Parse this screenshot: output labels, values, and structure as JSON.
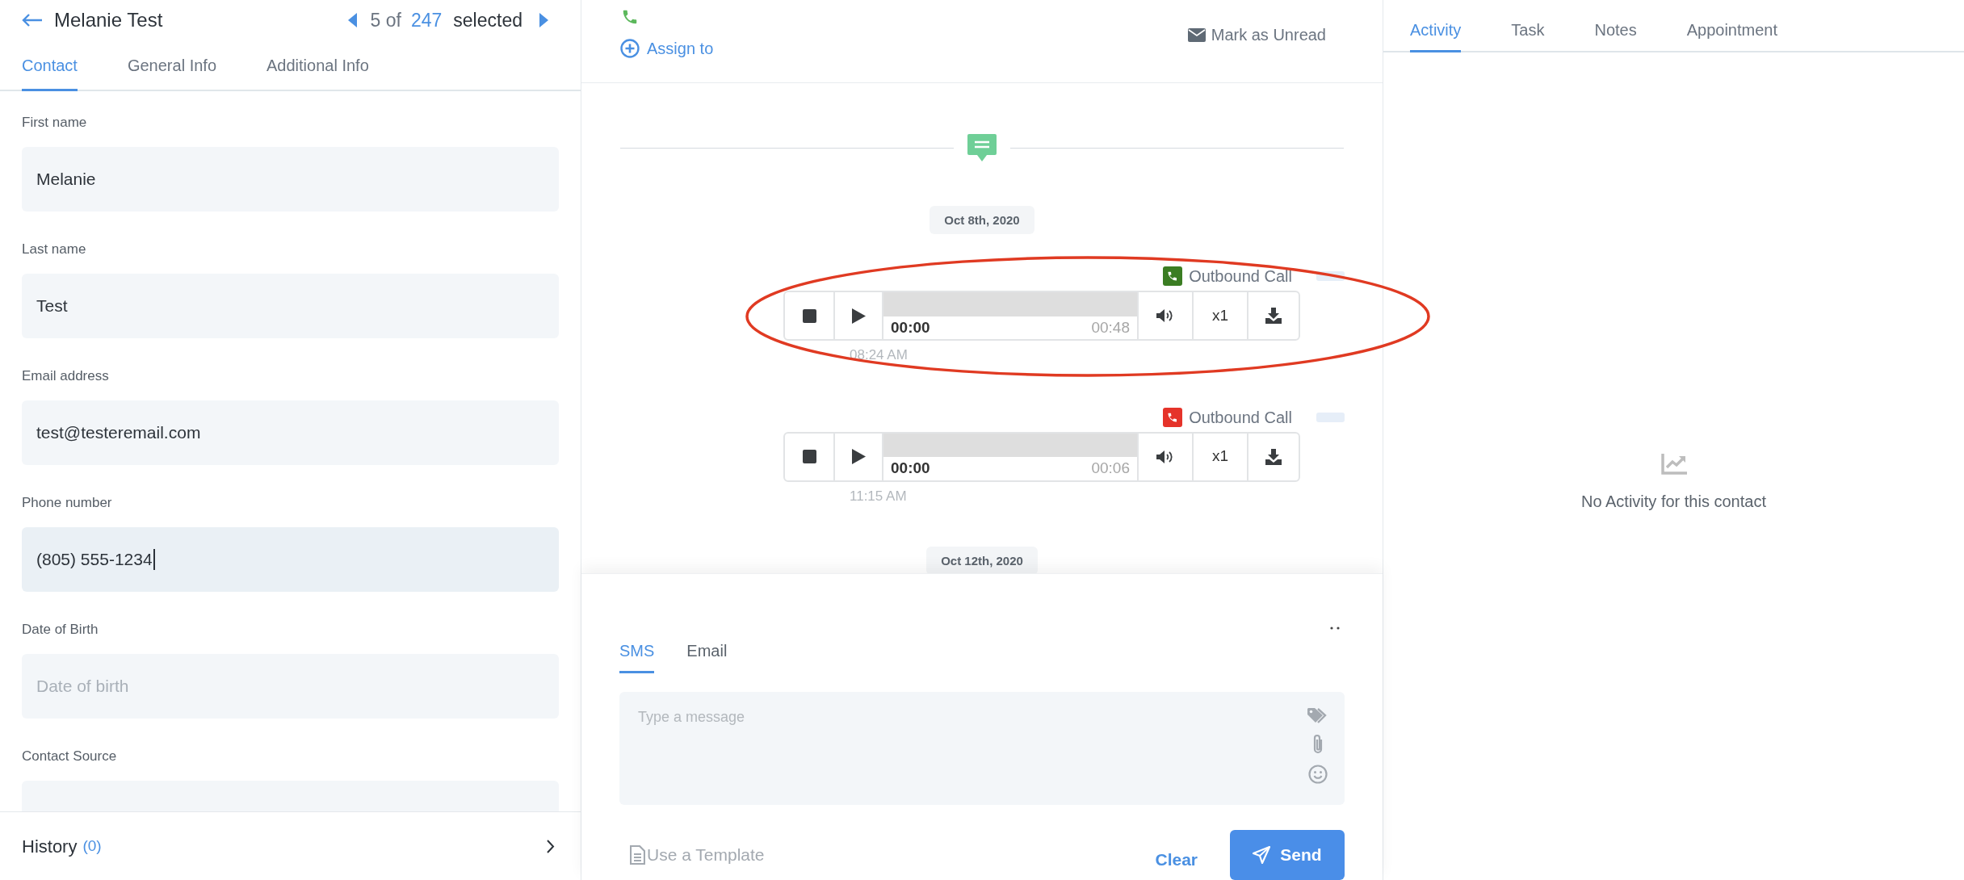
{
  "contact_header": {
    "title": "Melanie Test",
    "pager": {
      "position": "5 of",
      "total": "247",
      "label": "selected"
    }
  },
  "contact_tabs": [
    {
      "label": "Contact",
      "selected": true
    },
    {
      "label": "General Info",
      "selected": false
    },
    {
      "label": "Additional Info",
      "selected": false
    }
  ],
  "fields": [
    {
      "label": "First name",
      "value": "Melanie",
      "focused": false
    },
    {
      "label": "Last name",
      "value": "Test",
      "focused": false
    },
    {
      "label": "Email address",
      "value": "test@testeremail.com",
      "focused": false
    },
    {
      "label": "Phone number",
      "value": "(805) 555-1234",
      "focused": true
    },
    {
      "label": "Date of Birth",
      "placeholder": "Date of birth",
      "focused": false
    },
    {
      "label": "Contact Source",
      "focused": false
    }
  ],
  "history": {
    "label": "History",
    "count": "(0)"
  },
  "conversation": {
    "assign_label": "Assign to",
    "mark_unread": "Mark as Unread",
    "timeline": [
      {
        "kind": "date",
        "text": "Oct 8th, 2020"
      },
      {
        "kind": "call",
        "title": "Outbound Call",
        "color": "#3b7d23",
        "level": 0,
        "elapsed": "00:00",
        "duration": "00:48",
        "speed": "x1",
        "time": "08:24 AM"
      },
      {
        "kind": "call",
        "title": "Outbound Call",
        "color": "#e5332a",
        "level": 0,
        "elapsed": "00:00",
        "duration": "00:06",
        "speed": "x1",
        "time": "11:15 AM"
      },
      {
        "kind": "date",
        "text": "Oct 12th, 2020"
      }
    ]
  },
  "composer": {
    "tabs": [
      {
        "label": "SMS",
        "selected": true
      },
      {
        "label": "Email",
        "selected": false
      }
    ],
    "placeholder": "Type a message",
    "template": "Use a Template",
    "clear": "Clear",
    "send": "Send"
  },
  "activity_panel": {
    "tabs": [
      {
        "label": "Activity",
        "selected": true
      },
      {
        "label": "Task",
        "selected": false
      },
      {
        "label": "Notes",
        "selected": false
      },
      {
        "label": "Appointment",
        "selected": false
      }
    ],
    "empty_text": "No Activity for this contact"
  }
}
